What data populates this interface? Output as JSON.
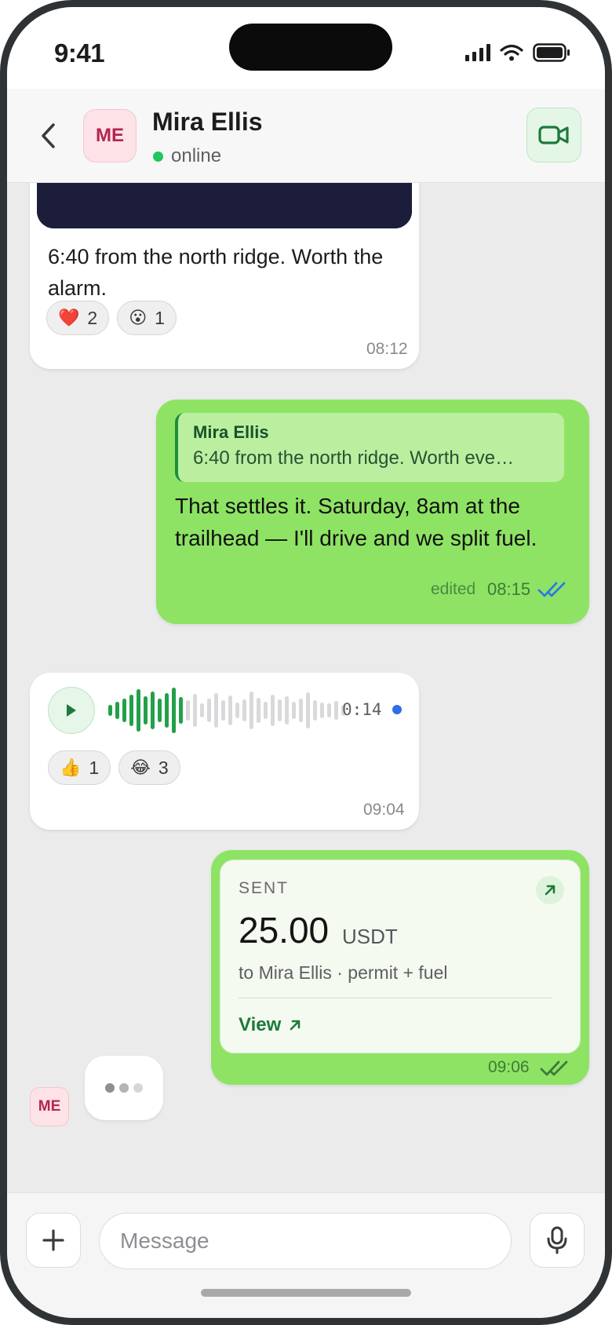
{
  "status_bar": {
    "time": "9:41",
    "icons": [
      "cellular-signal-icon",
      "wifi-icon",
      "battery-icon"
    ]
  },
  "header": {
    "back_icon": "chevron-left-icon",
    "avatar_initials": "ME",
    "contact_name": "Mira Ellis",
    "presence": "online",
    "video_icon": "video-camera-icon"
  },
  "colors": {
    "accent_green": "#1d7a3a",
    "outgoing_bubble": "#8ee364",
    "incoming_bubble": "#ffffff",
    "online_dot": "#22c55e",
    "read_check": "#2f7be0",
    "avatar_bg": "#fde2e7",
    "avatar_text": "#b3264e"
  },
  "messages": [
    {
      "type": "photo",
      "direction": "in",
      "text": "6:40 from the north ridge. Worth the alarm.",
      "reactions": [
        {
          "emoji": "❤️",
          "count": "2"
        },
        {
          "emoji": "😮",
          "count": "1"
        }
      ],
      "time": "08:12"
    },
    {
      "type": "reply",
      "direction": "out",
      "quote": {
        "author": "Mira Ellis",
        "text": "6:40 from the north ridge. Worth eve…"
      },
      "text": "That settles it. Saturday, 8am at the trailhead — I'll drive and we split fuel.",
      "edited_label": "edited",
      "time": "08:15",
      "status": "read"
    },
    {
      "type": "voice",
      "direction": "in",
      "duration": "0:14",
      "played_fraction": 0.31,
      "unplayed_indicator": true,
      "reactions": [
        {
          "emoji": "👍",
          "count": "1"
        },
        {
          "emoji": "😂",
          "count": "3"
        }
      ],
      "time": "09:04"
    },
    {
      "type": "transaction",
      "direction": "out",
      "label": "SENT",
      "amount": "25.00",
      "currency": "USDT",
      "note": "to Mira Ellis · permit + fuel",
      "link_label": "View",
      "time": "09:06",
      "status": "delivered"
    }
  ],
  "typing": {
    "avatar_initials": "ME"
  },
  "composer": {
    "placeholder": "Message",
    "value": "",
    "attach_icon": "plus-icon",
    "mic_icon": "microphone-icon"
  }
}
